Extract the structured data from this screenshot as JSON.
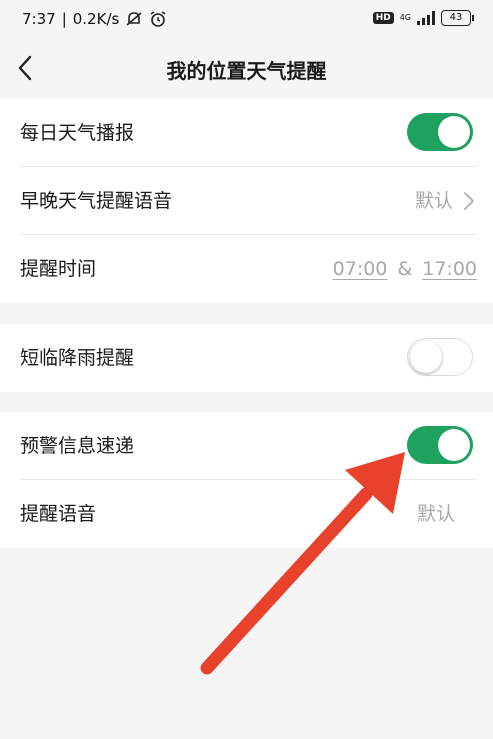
{
  "status_bar": {
    "time": "7:37",
    "speed": "0.2K/s",
    "hd_badge": "HD",
    "network": "4G",
    "battery": "43",
    "icons": [
      "mute-bell-icon",
      "alarm-clock-icon",
      "signal-icon",
      "battery-icon"
    ]
  },
  "header": {
    "back_icon": "chevron-left-icon",
    "title": "我的位置天气提醒"
  },
  "section1": {
    "daily_broadcast": {
      "label": "每日天气播报",
      "enabled": true
    },
    "voice": {
      "label": "早晚天气提醒语音",
      "value": "默认"
    },
    "time": {
      "label": "提醒时间",
      "morning": "07:00",
      "sep": "&",
      "evening": "17:00"
    }
  },
  "section2": {
    "rain_alert": {
      "label": "短临降雨提醒",
      "enabled": false
    }
  },
  "section3": {
    "warning": {
      "label": "预警信息速递",
      "enabled": true
    },
    "alert_voice": {
      "label": "提醒语音",
      "value": "默认"
    }
  },
  "colors": {
    "accent": "#1fa260",
    "annotation_arrow": "#e8412c"
  }
}
